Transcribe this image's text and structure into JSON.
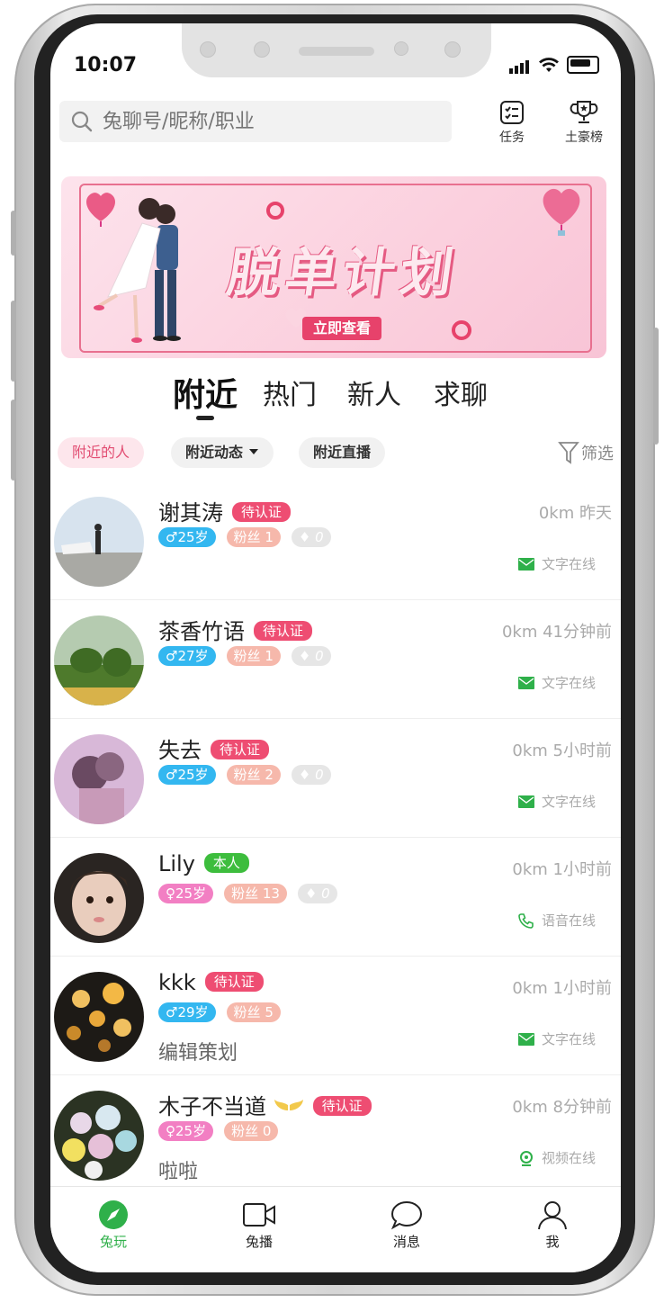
{
  "status": {
    "time": "10:07"
  },
  "search": {
    "placeholder": "兔聊号/昵称/职业"
  },
  "top_actions": [
    {
      "label": "任务",
      "icon": "task-list-icon"
    },
    {
      "label": "土豪榜",
      "icon": "trophy-icon"
    }
  ],
  "banner": {
    "title": "脱单计划",
    "button": "立即查看"
  },
  "tabs": [
    "附近",
    "热门",
    "新人",
    "求聊"
  ],
  "chips": [
    "附近的人",
    "附近动态",
    "附近直播"
  ],
  "filter": "筛选",
  "users": [
    {
      "name": "谢其涛",
      "badge": "待认证",
      "gender": "♂",
      "age": "25岁",
      "fans": "粉丝 1",
      "gifts": "0",
      "bio": "",
      "distance": "0km 昨天",
      "status": "文字在线",
      "status_icon": "message-icon"
    },
    {
      "name": "茶香竹语",
      "badge": "待认证",
      "gender": "♂",
      "age": "27岁",
      "fans": "粉丝 1",
      "gifts": "0",
      "bio": "",
      "distance": "0km 41分钟前",
      "status": "文字在线",
      "status_icon": "message-icon"
    },
    {
      "name": "失去",
      "badge": "待认证",
      "gender": "♂",
      "age": "25岁",
      "fans": "粉丝 2",
      "gifts": "0",
      "bio": "",
      "distance": "0km 5小时前",
      "status": "文字在线",
      "status_icon": "message-icon"
    },
    {
      "name": "Lily",
      "badge": "本人",
      "gender": "♀",
      "age": "25岁",
      "fans": "粉丝 13",
      "gifts": "0",
      "bio": "",
      "distance": "0km 1小时前",
      "status": "语音在线",
      "status_icon": "phone-icon"
    },
    {
      "name": "kkk",
      "badge": "待认证",
      "gender": "♂",
      "age": "29岁",
      "fans": "粉丝 5",
      "gifts": "",
      "bio": "编辑策划",
      "distance": "0km 1小时前",
      "status": "文字在线",
      "status_icon": "message-icon"
    },
    {
      "name": "木子不当道",
      "badge": "待认证",
      "gender": "♀",
      "age": "25岁",
      "fans": "粉丝 0",
      "gifts": "",
      "bio": "啦啦",
      "distance": "0km 8分钟前",
      "status": "视频在线",
      "status_icon": "video-icon"
    }
  ],
  "nav": [
    "兔玩",
    "兔播",
    "消息",
    "我"
  ],
  "colors": {
    "accent": "#ee4d72",
    "active": "#2fb04a",
    "male": "#33b7f0",
    "female": "#f27fc3"
  }
}
